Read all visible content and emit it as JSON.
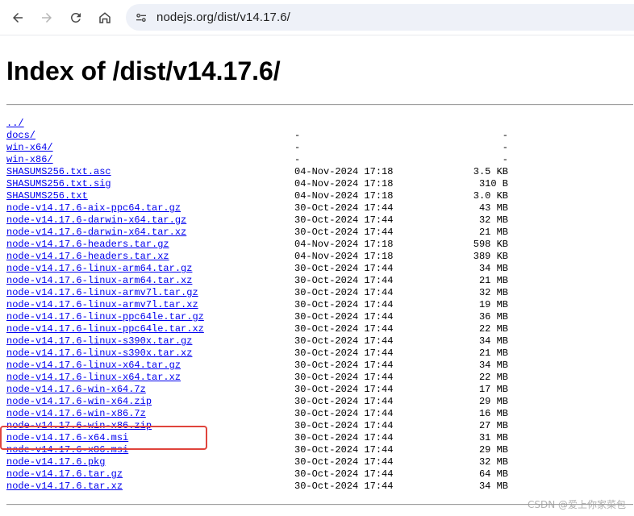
{
  "browser": {
    "url": "nodejs.org/dist/v14.17.6/",
    "icons": [
      "back-icon",
      "forward-icon",
      "reload-icon",
      "home-icon",
      "site-info-icon"
    ]
  },
  "page": {
    "heading": "Index of /dist/v14.17.6/",
    "link_color": "#0000ee",
    "files": [
      {
        "name": "../",
        "date": "",
        "size": ""
      },
      {
        "name": "docs/",
        "date": "-",
        "size": "-"
      },
      {
        "name": "win-x64/",
        "date": "-",
        "size": "-"
      },
      {
        "name": "win-x86/",
        "date": "-",
        "size": "-"
      },
      {
        "name": "SHASUMS256.txt.asc",
        "date": "04-Nov-2024 17:18",
        "size": "3.5 KB"
      },
      {
        "name": "SHASUMS256.txt.sig",
        "date": "04-Nov-2024 17:18",
        "size": "310 B"
      },
      {
        "name": "SHASUMS256.txt",
        "date": "04-Nov-2024 17:18",
        "size": "3.0 KB"
      },
      {
        "name": "node-v14.17.6-aix-ppc64.tar.gz",
        "date": "30-Oct-2024 17:44",
        "size": "43 MB"
      },
      {
        "name": "node-v14.17.6-darwin-x64.tar.gz",
        "date": "30-Oct-2024 17:44",
        "size": "32 MB"
      },
      {
        "name": "node-v14.17.6-darwin-x64.tar.xz",
        "date": "30-Oct-2024 17:44",
        "size": "21 MB"
      },
      {
        "name": "node-v14.17.6-headers.tar.gz",
        "date": "04-Nov-2024 17:18",
        "size": "598 KB"
      },
      {
        "name": "node-v14.17.6-headers.tar.xz",
        "date": "04-Nov-2024 17:18",
        "size": "389 KB"
      },
      {
        "name": "node-v14.17.6-linux-arm64.tar.gz",
        "date": "30-Oct-2024 17:44",
        "size": "34 MB"
      },
      {
        "name": "node-v14.17.6-linux-arm64.tar.xz",
        "date": "30-Oct-2024 17:44",
        "size": "21 MB"
      },
      {
        "name": "node-v14.17.6-linux-armv7l.tar.gz",
        "date": "30-Oct-2024 17:44",
        "size": "32 MB"
      },
      {
        "name": "node-v14.17.6-linux-armv7l.tar.xz",
        "date": "30-Oct-2024 17:44",
        "size": "19 MB"
      },
      {
        "name": "node-v14.17.6-linux-ppc64le.tar.gz",
        "date": "30-Oct-2024 17:44",
        "size": "36 MB"
      },
      {
        "name": "node-v14.17.6-linux-ppc64le.tar.xz",
        "date": "30-Oct-2024 17:44",
        "size": "22 MB"
      },
      {
        "name": "node-v14.17.6-linux-s390x.tar.gz",
        "date": "30-Oct-2024 17:44",
        "size": "34 MB"
      },
      {
        "name": "node-v14.17.6-linux-s390x.tar.xz",
        "date": "30-Oct-2024 17:44",
        "size": "21 MB"
      },
      {
        "name": "node-v14.17.6-linux-x64.tar.gz",
        "date": "30-Oct-2024 17:44",
        "size": "34 MB"
      },
      {
        "name": "node-v14.17.6-linux-x64.tar.xz",
        "date": "30-Oct-2024 17:44",
        "size": "22 MB"
      },
      {
        "name": "node-v14.17.6-win-x64.7z",
        "date": "30-Oct-2024 17:44",
        "size": "17 MB"
      },
      {
        "name": "node-v14.17.6-win-x64.zip",
        "date": "30-Oct-2024 17:44",
        "size": "29 MB"
      },
      {
        "name": "node-v14.17.6-win-x86.7z",
        "date": "30-Oct-2024 17:44",
        "size": "16 MB"
      },
      {
        "name": "node-v14.17.6-win-x86.zip",
        "date": "30-Oct-2024 17:44",
        "size": "27 MB"
      },
      {
        "name": "node-v14.17.6-x64.msi",
        "date": "30-Oct-2024 17:44",
        "size": "31 MB"
      },
      {
        "name": "node-v14.17.6-x86.msi",
        "date": "30-Oct-2024 17:44",
        "size": "29 MB"
      },
      {
        "name": "node-v14.17.6.pkg",
        "date": "30-Oct-2024 17:44",
        "size": "32 MB"
      },
      {
        "name": "node-v14.17.6.tar.gz",
        "date": "30-Oct-2024 17:44",
        "size": "64 MB"
      },
      {
        "name": "node-v14.17.6.tar.xz",
        "date": "30-Oct-2024 17:44",
        "size": "34 MB"
      }
    ],
    "highlighted_file": "node-v14.17.6-win-x64.zip",
    "highlight_color": "#e0443c"
  },
  "watermark": "CSDN @爱上你家菜包"
}
